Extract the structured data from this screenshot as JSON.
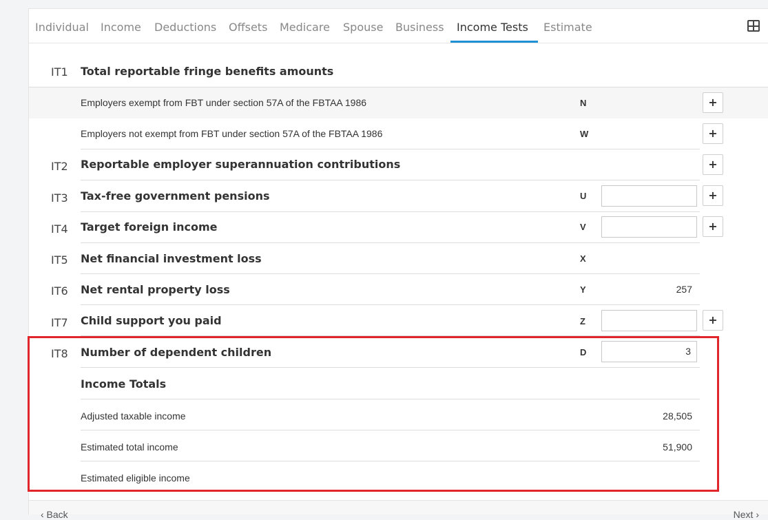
{
  "tabs": [
    {
      "label": "Individual"
    },
    {
      "label": "Income"
    },
    {
      "label": "Deductions"
    },
    {
      "label": "Offsets"
    },
    {
      "label": "Medicare"
    },
    {
      "label": "Spouse"
    },
    {
      "label": "Business"
    },
    {
      "label": "Income Tests",
      "active": true
    },
    {
      "label": "Estimate"
    }
  ],
  "icons": {
    "layout_toggle": "grid-icon"
  },
  "accent_color": "#1e90d6",
  "highlight_color": "#e0262b",
  "items": {
    "it1": {
      "code": "IT1",
      "title": "Total reportable fringe benefits amounts"
    },
    "it1_n": {
      "label": "Employers exempt from FBT under section 57A of the FBTAA 1986",
      "letter": "N"
    },
    "it1_w": {
      "label": "Employers not exempt from FBT under section 57A of the FBTAA 1986",
      "letter": "W"
    },
    "it2": {
      "code": "IT2",
      "title": "Reportable employer superannuation contributions"
    },
    "it3": {
      "code": "IT3",
      "title": "Tax-free government pensions",
      "letter": "U",
      "value": ""
    },
    "it4": {
      "code": "IT4",
      "title": "Target foreign income",
      "letter": "V",
      "value": ""
    },
    "it5": {
      "code": "IT5",
      "title": "Net financial investment loss",
      "letter": "X"
    },
    "it6": {
      "code": "IT6",
      "title": "Net rental property loss",
      "letter": "Y",
      "value": "257"
    },
    "it7": {
      "code": "IT7",
      "title": "Child support you paid",
      "letter": "Z",
      "value": ""
    },
    "it8": {
      "code": "IT8",
      "title": "Number of dependent children",
      "letter": "D",
      "value": "3"
    }
  },
  "plus_label": "+",
  "totals": {
    "heading": "Income Totals",
    "adjusted_taxable": {
      "label": "Adjusted taxable income",
      "value": "28,505"
    },
    "estimated_total": {
      "label": "Estimated total income",
      "value": "51,900"
    },
    "estimated_eligible": {
      "label": "Estimated eligible income",
      "value": ""
    }
  },
  "footer": {
    "prev": "‹ Back",
    "next": "Next ›"
  }
}
